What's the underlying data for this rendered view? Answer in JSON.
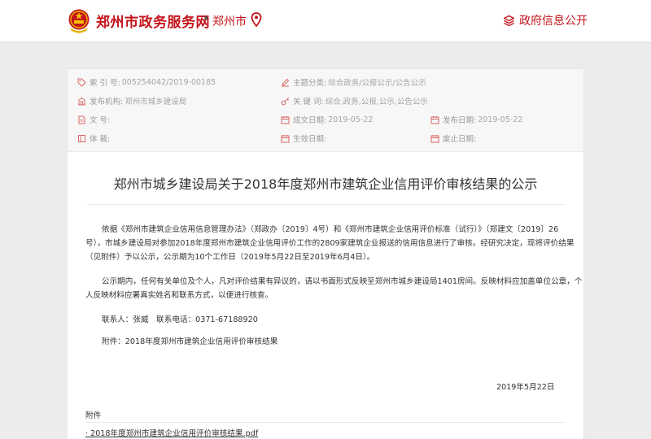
{
  "header": {
    "site_title": "郑州市政务服务网",
    "dot": "•",
    "city": "郑州市",
    "gov_info": "政府信息公开",
    "accent": "#c4131b"
  },
  "meta": {
    "index_label": "索 引 号:",
    "index_value": "005254042/2019-00185",
    "category_label": "主题分类:",
    "category_value": "综合政务/公报公示/公告公示",
    "issuer_label": "发布机构:",
    "issuer_value": "郑州市城乡建设局",
    "keywords_label": "关 键 词:",
    "keywords_value": "综合,政务,公报,公示,公告公示",
    "docno_label": "文 号:",
    "docno_value": "",
    "created_label": "成文日期:",
    "created_value": "2019-05-22",
    "published_label": "发布日期:",
    "published_value": "2019-05-22",
    "form_label": "体 裁:",
    "form_value": "",
    "effective_label": "生效日期:",
    "effective_value": "",
    "abolish_label": "废止日期:",
    "abolish_value": ""
  },
  "article": {
    "title": "郑州市城乡建设局关于2018年度郑州市建筑企业信用评价审核结果的公示",
    "para1_l1": "依据《郑州市建筑企业信用信息管理办法》（郑政办〔2019〕4号）和《郑州市建筑企业信用评价标准（试行）》（郑建文〔2019〕26",
    "para1_l2": "号），市城乡建设局对参加2018年度郑州市建筑企业信用评价工作的2809家建筑企业报送的信用信息进行了审核。经研究决定，现将评价结果",
    "para1_l3": "（见附件）予以公示，公示期为10个工作日（2019年5月22日至2019年6月4日）。",
    "para2_l1": "公示期内，任何有关单位及个人，凡对评价结果有异议的，请以书面形式反映至郑州市城乡建设局1401房间。反映材料应加盖单位公章，个",
    "para2_l2": "人反映材料应署真实姓名和联系方式，以便进行核查。",
    "contact": "联系人：张威　联系电话：0371-67188920",
    "attachment_line": "附件：2018年度郑州市建筑企业信用评价审核结果",
    "date": "2019年5月22日",
    "attach_label": "附件",
    "attach_file": "· 2018年度郑州市建筑企业信用评价审核结果.pdf"
  }
}
